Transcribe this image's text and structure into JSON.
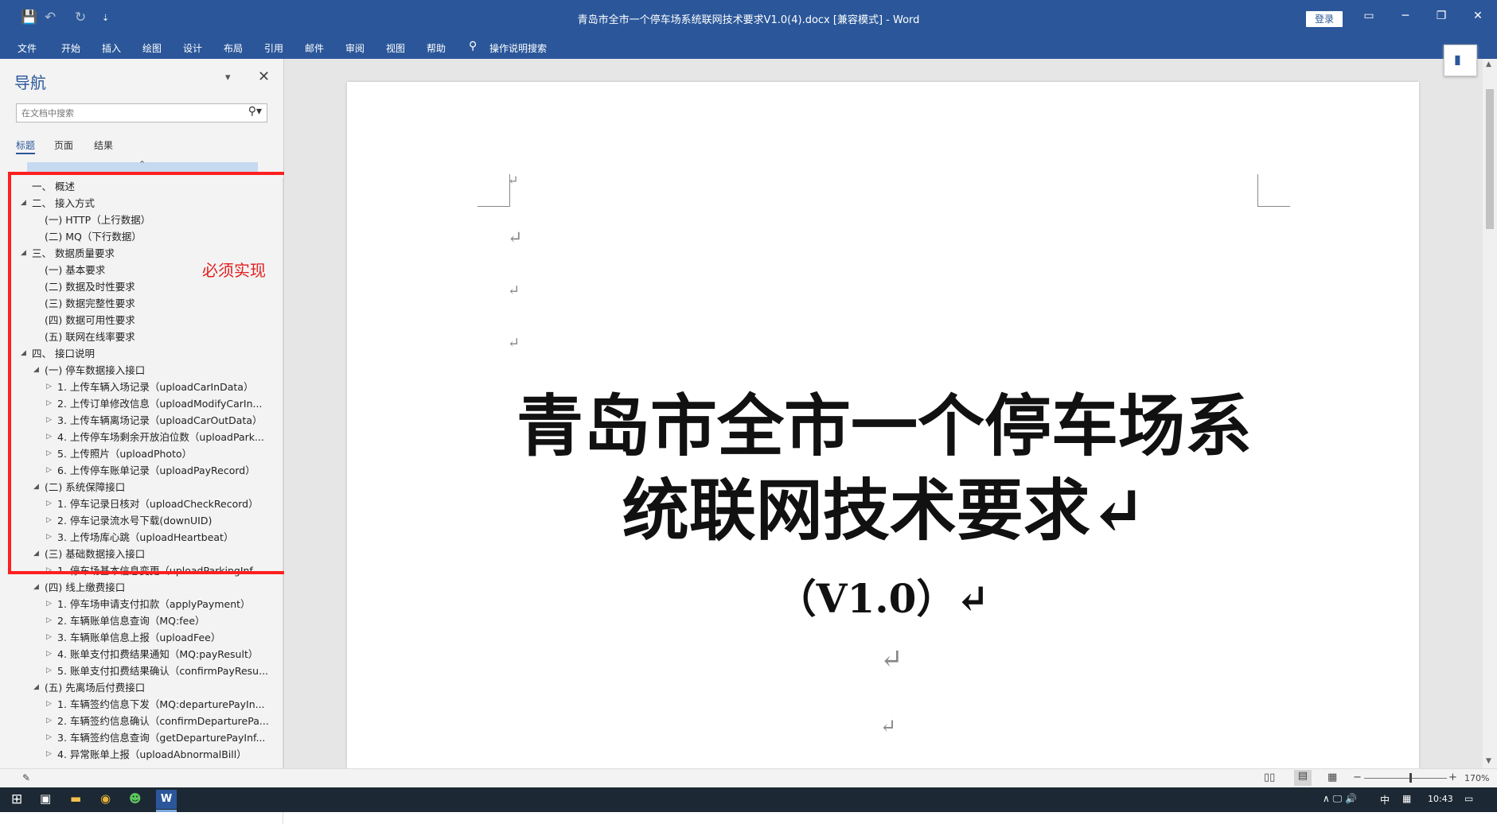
{
  "app": {
    "title": "青岛市全市一个停车场系统联网技术要求V1.0(4).docx [兼容模式] - Word",
    "login_label": "登录",
    "quick_access": {
      "save": "💾",
      "undo": "↶",
      "redo": "↻",
      "customize": "⇣"
    },
    "window_controls": {
      "ribbon_display": "▭",
      "minimize": "─",
      "restore": "❐",
      "close": "✕"
    }
  },
  "ribbon": {
    "tabs": [
      "文件",
      "开始",
      "插入",
      "绘图",
      "设计",
      "布局",
      "引用",
      "邮件",
      "审阅",
      "视图",
      "帮助"
    ],
    "tell_me": "操作说明搜索"
  },
  "nav": {
    "title": "导航",
    "search_placeholder": "在文档中搜索",
    "tabs": [
      "标题",
      "页面",
      "结果"
    ],
    "items": [
      {
        "text": "一、 概述",
        "level": 0,
        "arrow": "none"
      },
      {
        "text": "二、 接入方式",
        "level": 0,
        "arrow": "open"
      },
      {
        "text": "(一) HTTP（上行数据）",
        "level": 1,
        "arrow": "none"
      },
      {
        "text": "(二) MQ（下行数据）",
        "level": 1,
        "arrow": "none"
      },
      {
        "text": "三、 数据质量要求",
        "level": 0,
        "arrow": "open"
      },
      {
        "text": "(一) 基本要求",
        "level": 1,
        "arrow": "none"
      },
      {
        "text": "(二) 数据及时性要求",
        "level": 1,
        "arrow": "none"
      },
      {
        "text": "(三) 数据完整性要求",
        "level": 1,
        "arrow": "none"
      },
      {
        "text": "(四) 数据可用性要求",
        "level": 1,
        "arrow": "none"
      },
      {
        "text": "(五) 联网在线率要求",
        "level": 1,
        "arrow": "none"
      },
      {
        "text": "四、 接口说明",
        "level": 0,
        "arrow": "open"
      },
      {
        "text": "(一) 停车数据接入接口",
        "level": 1,
        "arrow": "open"
      },
      {
        "text": "1. 上传车辆入场记录（uploadCarInData）",
        "level": 2,
        "arrow": "closed"
      },
      {
        "text": "2. 上传订单修改信息（uploadModifyCarIn...",
        "level": 2,
        "arrow": "closed"
      },
      {
        "text": "3. 上传车辆离场记录（uploadCarOutData）",
        "level": 2,
        "arrow": "closed"
      },
      {
        "text": "4. 上传停车场剩余开放泊位数（uploadPark...",
        "level": 2,
        "arrow": "closed"
      },
      {
        "text": "5. 上传照片（uploadPhoto）",
        "level": 2,
        "arrow": "closed"
      },
      {
        "text": "6. 上传停车账单记录（uploadPayRecord）",
        "level": 2,
        "arrow": "closed"
      },
      {
        "text": "(二) 系统保障接口",
        "level": 1,
        "arrow": "open"
      },
      {
        "text": "1. 停车记录日核对（uploadCheckRecord）",
        "level": 2,
        "arrow": "closed"
      },
      {
        "text": "2. 停车记录流水号下载(downUID)",
        "level": 2,
        "arrow": "closed"
      },
      {
        "text": "3. 上传场库心跳（uploadHeartbeat）",
        "level": 2,
        "arrow": "closed"
      },
      {
        "text": "(三) 基础数据接入接口",
        "level": 1,
        "arrow": "open"
      },
      {
        "text": "1. 停车场基本信息变更（uploadParkingInf...",
        "level": 2,
        "arrow": "closed"
      },
      {
        "text": "(四) 线上缴费接口",
        "level": 1,
        "arrow": "open"
      },
      {
        "text": "1. 停车场申请支付扣款（applyPayment）",
        "level": 2,
        "arrow": "closed"
      },
      {
        "text": "2. 车辆账单信息查询（MQ:fee）",
        "level": 2,
        "arrow": "closed"
      },
      {
        "text": "3. 车辆账单信息上报（uploadFee）",
        "level": 2,
        "arrow": "closed"
      },
      {
        "text": "4. 账单支付扣费结果通知（MQ:payResult）",
        "level": 2,
        "arrow": "closed"
      },
      {
        "text": "5. 账单支付扣费结果确认（confirmPayResu...",
        "level": 2,
        "arrow": "closed"
      },
      {
        "text": "(五) 先离场后付费接口",
        "level": 1,
        "arrow": "open"
      },
      {
        "text": "1. 车辆签约信息下发（MQ:departurePayIn...",
        "level": 2,
        "arrow": "closed"
      },
      {
        "text": "2. 车辆签约信息确认（confirmDeparturePa...",
        "level": 2,
        "arrow": "closed"
      },
      {
        "text": "3. 车辆签约信息查询（getDeparturePayInf...",
        "level": 2,
        "arrow": "closed"
      },
      {
        "text": "4. 异常账单上报（uploadAbnormalBill）",
        "level": 2,
        "arrow": "closed"
      }
    ]
  },
  "annotation": {
    "label": "必须实现",
    "color": "#ff1f1f"
  },
  "document": {
    "heading_line1": "青岛市全市一个停车场系",
    "heading_line2": "统联网技术要求↵",
    "version": "（V1.0）↵",
    "para_mark": "↵"
  },
  "status": {
    "zoom": "170%",
    "zoom_minus": "−",
    "zoom_plus": "+"
  },
  "taskbar": {
    "time": "10:43",
    "ime": "中",
    "tray": "∧ 🖵 🔊",
    "word_label": "W"
  },
  "colors": {
    "word_blue": "#2b579a",
    "annotation_red": "#ff1f1f"
  }
}
